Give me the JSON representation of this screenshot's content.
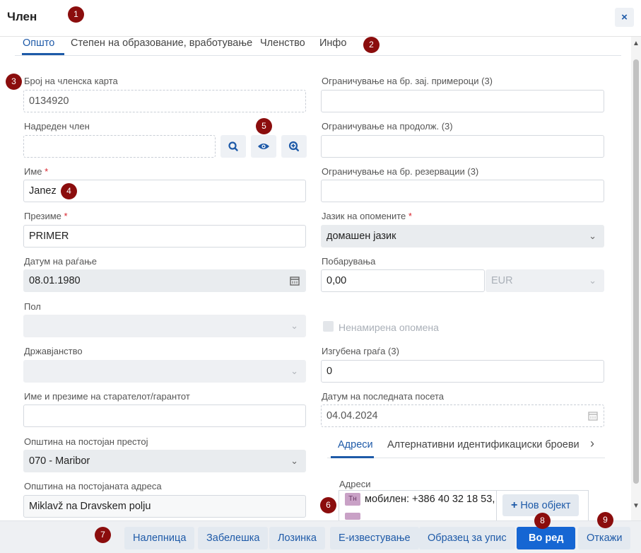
{
  "window": {
    "title": "Член",
    "close_symbol": "×"
  },
  "badges": [
    "1",
    "2",
    "3",
    "4",
    "5",
    "6",
    "7",
    "8",
    "9"
  ],
  "tabs": [
    "Општо",
    "Степен на образование, вработување",
    "Членство",
    "Инфо"
  ],
  "left": {
    "card_label": "Број на членска карта",
    "card_value": "0134920",
    "superior_label": "Надреден член",
    "superior_value": "",
    "name_label": "Име",
    "name_value": "Janez",
    "surname_label": "Презиме",
    "surname_value": "PRIMER",
    "birth_label": "Датум на раѓање",
    "birth_value": "08.01.1980",
    "gender_label": "Пол",
    "gender_value": "",
    "citizenship_label": "Државјанство",
    "citizenship_value": "",
    "guardian_label": "Име и презиме на старателот/гарантот",
    "guardian_value": "",
    "municipality_label": "Општина на постојан престој",
    "municipality_value": "070  -  Maribor",
    "municipality_addr_label": "Општина на постојаната адреса",
    "municipality_addr_value": "Miklavž na Dravskem polju"
  },
  "right": {
    "limit_loans_label": "Ограничување на бр. зај. примероци (3)",
    "limit_loans_value": "",
    "limit_renew_label": "Ограничување на продолж. (3)",
    "limit_renew_value": "",
    "limit_res_label": "Ограничување на бр. резервации (3)",
    "limit_res_value": "",
    "reminder_lang_label": "Јазик на опомените",
    "reminder_lang_value": "домашен јазик",
    "claims_label": "Побарувања",
    "claims_value": "0,00",
    "claims_currency": "EUR",
    "unintended_reminder_label": "Ненамирена опомена",
    "lost_label": "Изгубена граѓа (3)",
    "lost_value": "0",
    "last_visit_label": "Датум на последната посета",
    "last_visit_value": "04.04.2024",
    "subtabs": [
      "Адреси",
      "Алтернативни идентификациски броеви"
    ],
    "addresses_label": "Адреси",
    "address_type": "Тн",
    "address_text": "мобилен: +386 40 32 18 53,",
    "new_object": "Нов објект"
  },
  "footer": {
    "buttons": [
      "Налепница",
      "Забелешка",
      "Лозинка",
      "Е-известување",
      "Образец за упис"
    ],
    "ok": "Во ред",
    "cancel": "Откажи"
  },
  "colors": {
    "accent": "#1e5aa8",
    "primary_button": "#1666d3",
    "required": "#d9232d",
    "badge": "#8b0d0d"
  }
}
